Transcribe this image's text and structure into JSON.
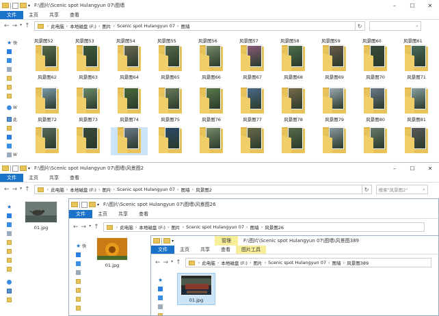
{
  "win1": {
    "title": "F:\\图片\\Scenic spot Hulangyun 07\\图墙",
    "ribbon": [
      "文件",
      "主页",
      "共享",
      "查看"
    ],
    "crumbs": [
      "此电脑",
      "本地磁盘 (F:)",
      "图片",
      "Scenic spot Hulangyun 07",
      "图墙"
    ],
    "nav": [
      "快",
      "W",
      "此",
      "W"
    ],
    "row_labels_top": [
      "风景图52",
      "风景图53",
      "风景图54",
      "风景图55",
      "风景图56",
      "风景图57",
      "风景图58",
      "风景图59",
      "风景图60",
      "风景图61"
    ],
    "rows": [
      [
        "风景图62",
        "风景图63",
        "风景图64",
        "风景图65",
        "风景图66",
        "风景图67",
        "风景图68",
        "风景图69",
        "风景图70",
        "风景图71"
      ],
      [
        "风景图72",
        "风景图73",
        "风景图74",
        "风景图75",
        "风景图76",
        "风景图77",
        "风景图78",
        "风景图79",
        "风景图80",
        "风景图81"
      ],
      [
        "",
        "",
        "",
        "",
        "",
        "",
        "",
        "",
        "",
        ""
      ]
    ],
    "photo_colors": [
      [
        "#5a6a4a",
        "#3d5a3a",
        "#6b6a55",
        "#556b4a",
        "#7a8a6a",
        "#8a5a7a",
        "#4e6e4e",
        "#6a5a4a",
        "#3a4a3a",
        "#4a6a5a"
      ],
      [
        "#7a9aaa",
        "#6a8a6a",
        "#4a6a3a",
        "#6a7a5a",
        "#5a7a4a",
        "#4a6a8a",
        "#7a6a4a",
        "#9aaab0",
        "#6a7a8a",
        "#8aa0a0"
      ],
      [
        "#5a6a5a",
        "#3a4a3a",
        "#6a7a8a",
        "#2a4a6a",
        "#7a8a6a",
        "#6a6a4a",
        "#5a6a4a",
        "#8a9aa0",
        "#6a7a6a",
        "#5a5a5a"
      ]
    ]
  },
  "win2": {
    "title": "F:\\图片\\Scenic spot Hulangyun 07\\图墙\\风景图2",
    "ribbon": [
      "文件",
      "主页",
      "共享",
      "查看"
    ],
    "crumbs": [
      "此电脑",
      "本地磁盘 (F:)",
      "图片",
      "Scenic spot Hulangyun 07",
      "图墙",
      "风景图2"
    ],
    "search": "搜索\"风景图2\"",
    "file": "01.jpg"
  },
  "win3": {
    "title": "F:\\图片\\Scenic spot Hulangyun 07\\图墙\\风景图26",
    "ribbon": [
      "文件",
      "主页",
      "共享",
      "查看"
    ],
    "crumbs": [
      "此电脑",
      "本地磁盘 (F:)",
      "图片",
      "Scenic spot Hulangyun 07",
      "图墙",
      "风景图26"
    ],
    "nav": [
      "快"
    ],
    "file": "01.jpg"
  },
  "win4": {
    "title": "F:\\图片\\Scenic spot Hulangyun 07\\图墙\\风景图389",
    "manage": "管理",
    "picture_tools": "图片工具",
    "ribbon": [
      "文件",
      "主页",
      "共享",
      "查看"
    ],
    "crumbs": [
      "此电脑",
      "本地磁盘 (F:)",
      "图片",
      "Scenic spot Hulangyun 07",
      "图墙",
      "风景图389"
    ],
    "file": "01.jpg"
  },
  "controls": {
    "min": "–",
    "max": "☐",
    "close": "✕",
    "back": "←",
    "forward": "→",
    "up": "↑",
    "refresh": "↻",
    "search_icon": "⌕"
  }
}
